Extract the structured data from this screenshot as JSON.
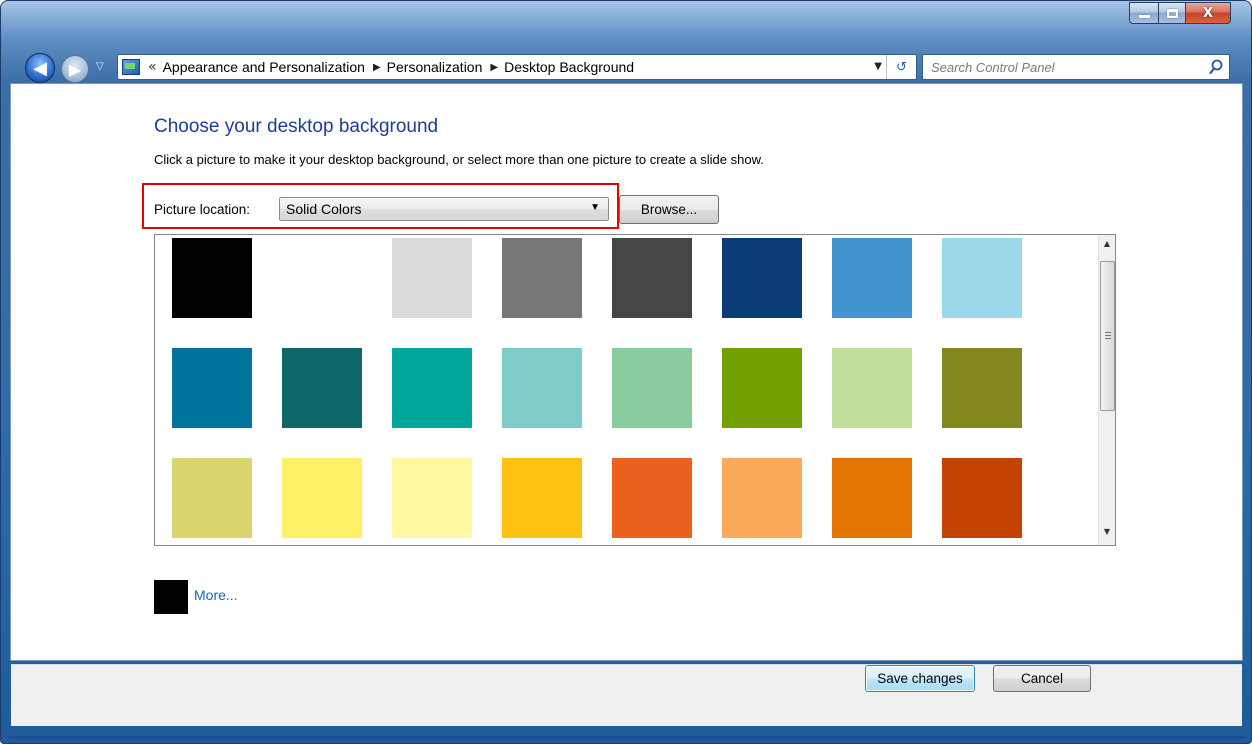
{
  "window": {
    "caption_buttons": {
      "minimize_icon": "minimize-icon",
      "maximize_icon": "maximize-icon",
      "close_label": "X"
    }
  },
  "nav": {
    "back_glyph": "◀",
    "forward_glyph": "▶",
    "recent_glyph": "▽"
  },
  "address": {
    "overflow_glyph": "«",
    "crumbs": [
      "Appearance and Personalization",
      "Personalization",
      "Desktop Background"
    ],
    "separator": "▶",
    "dropdown_glyph": "▼",
    "refresh_glyph": "↺"
  },
  "search": {
    "placeholder": "Search Control Panel"
  },
  "page": {
    "title": "Choose your desktop background",
    "subtitle": "Click a picture to make it your desktop background, or select more than one picture to create a slide show.",
    "location_label": "Picture location:",
    "location_value": "Solid Colors",
    "location_arrow": "▼",
    "browse_label": "Browse..."
  },
  "gallery": {
    "colors": [
      "#000000",
      "#ffffff",
      "#dcdcdc",
      "#777777",
      "#464646",
      "#0b3c78",
      "#4395d0",
      "#9bd9ea",
      "#00739d",
      "#0f6868",
      "#00a89b",
      "#7ecdc9",
      "#88cc9d",
      "#73a200",
      "#c3df9b",
      "#84871e",
      "#dad56f",
      "#fff066",
      "#fff8a0",
      "#ffc210",
      "#eb611d",
      "#fcaa5c",
      "#e47400",
      "#c24400"
    ],
    "scroll_up": "▲",
    "scroll_down": "▼"
  },
  "more": {
    "label": "More...",
    "swatch_color": "#000000"
  },
  "footer": {
    "save_label": "Save changes",
    "cancel_label": "Cancel"
  }
}
